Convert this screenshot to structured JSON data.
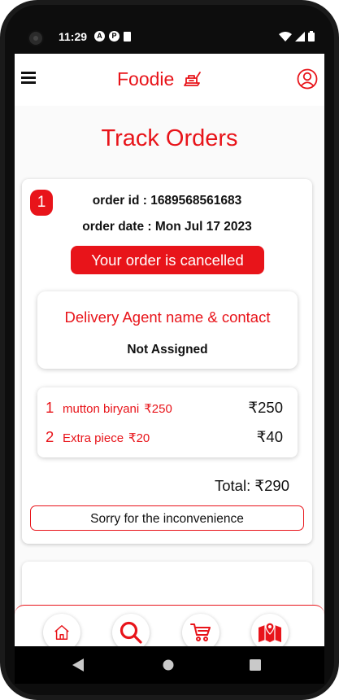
{
  "status_bar": {
    "time": "11:29",
    "notif_icon_1": "A",
    "notif_icon_2": "P"
  },
  "app": {
    "brand": "Foodie",
    "brand_icon": "food-tray-icon",
    "accent_color": "#e8141a"
  },
  "page": {
    "title": "Track Orders"
  },
  "orders": [
    {
      "number": "1",
      "order_id_text": "order id : 1689568561683",
      "order_date_text": "order date : Mon Jul 17 2023",
      "status": "Your order is cancelled",
      "agent_title": "Delivery Agent name & contact",
      "agent_status": "Not Assigned",
      "items": [
        {
          "index": "1",
          "name": "mutton biryani",
          "unit_price": "₹250",
          "line_total": "₹250"
        },
        {
          "index": "2",
          "name": "Extra piece",
          "unit_price": "₹20",
          "line_total": "₹40"
        }
      ],
      "total_text": "Total: ₹290",
      "message": "Sorry for the inconvenience"
    }
  ],
  "bottom_nav": [
    {
      "name": "home",
      "icon": "home-icon"
    },
    {
      "name": "search",
      "icon": "search-icon"
    },
    {
      "name": "cart",
      "icon": "cart-icon"
    },
    {
      "name": "map",
      "icon": "map-icon"
    }
  ]
}
